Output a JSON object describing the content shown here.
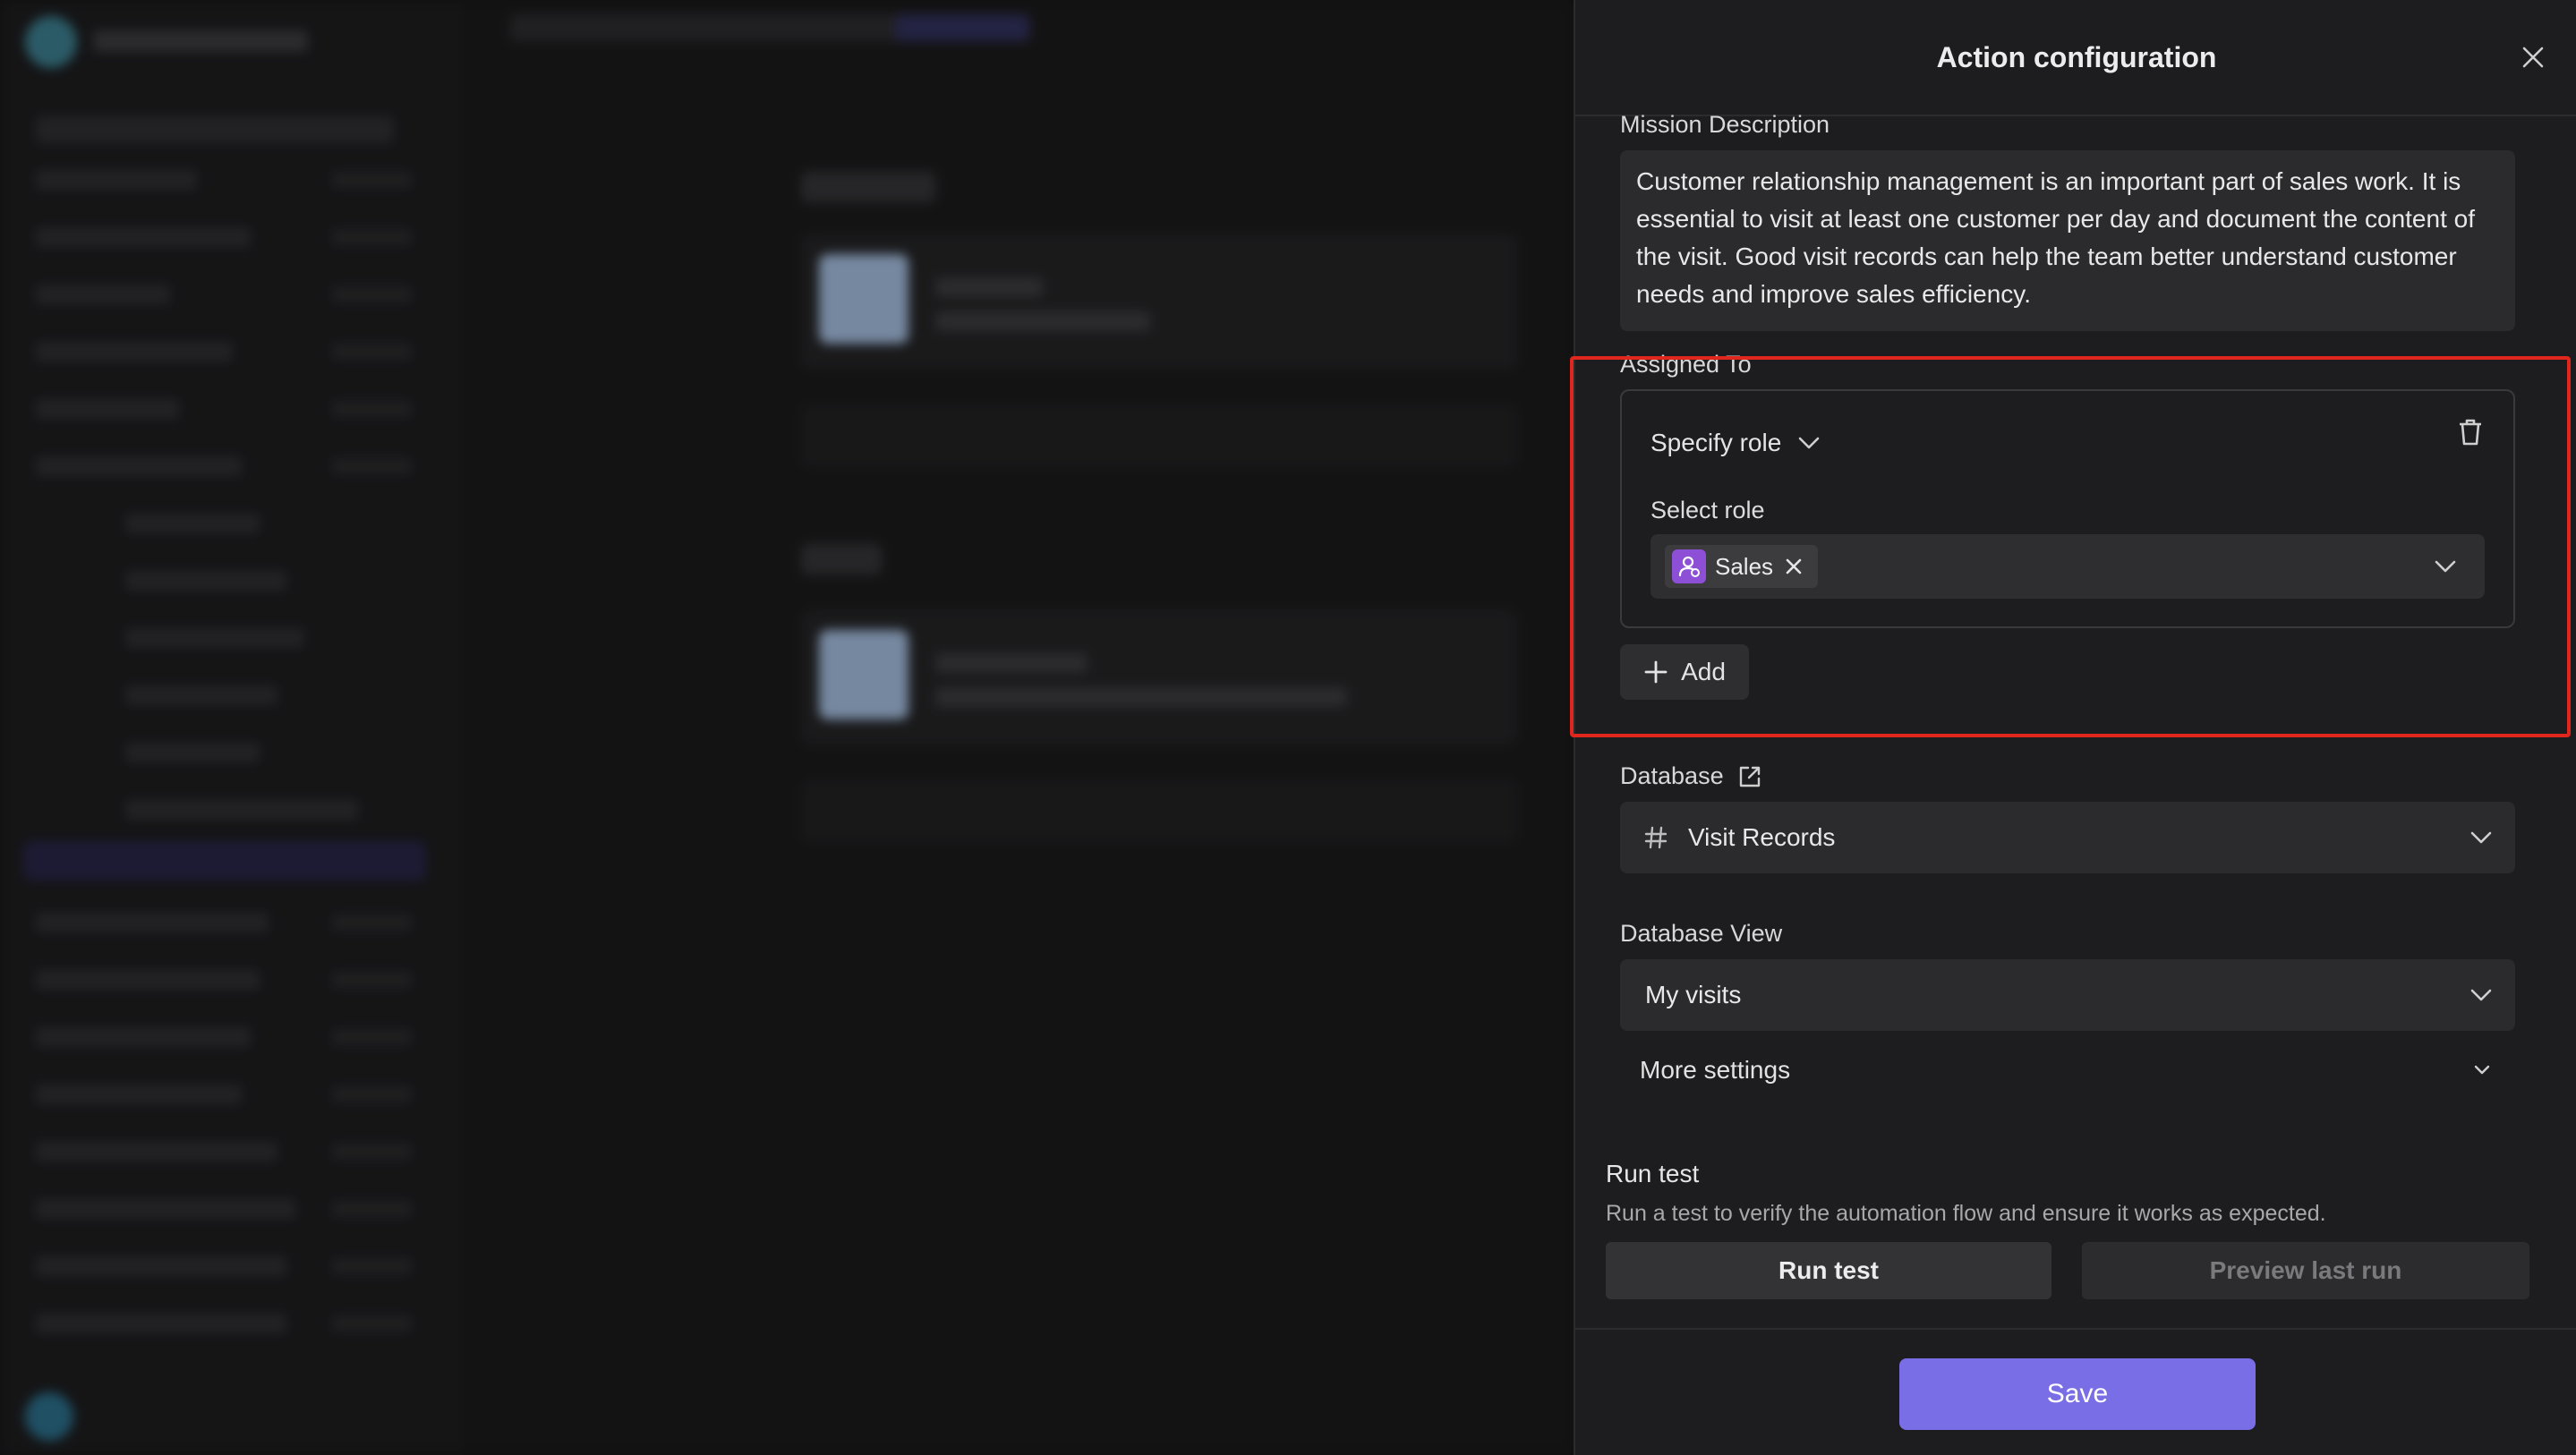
{
  "panel": {
    "title": "Action configuration"
  },
  "mission": {
    "label": "Mission Description",
    "value": "Customer relationship management is an important part of sales work. It is essential to visit at least one customer per day and document the content of the visit. Good visit records can help the team better understand customer needs and improve sales efficiency."
  },
  "assigned": {
    "label": "Assigned To",
    "mode": "Specify role",
    "select_role_label": "Select role",
    "selected_roles": [
      "Sales"
    ],
    "add_label": "Add"
  },
  "database": {
    "label": "Database",
    "value": "Visit Records"
  },
  "database_view": {
    "label": "Database View",
    "value": "My visits"
  },
  "more_settings": "More settings",
  "run": {
    "title": "Run test",
    "description": "Run a test to verify the automation flow and ensure it works as expected.",
    "run_label": "Run test",
    "preview_label": "Preview last run"
  },
  "footer": {
    "save_label": "Save"
  },
  "colors": {
    "accent": "#7a6ee6",
    "highlight": "#e0261d",
    "role_icon": "#8c4fd6"
  }
}
